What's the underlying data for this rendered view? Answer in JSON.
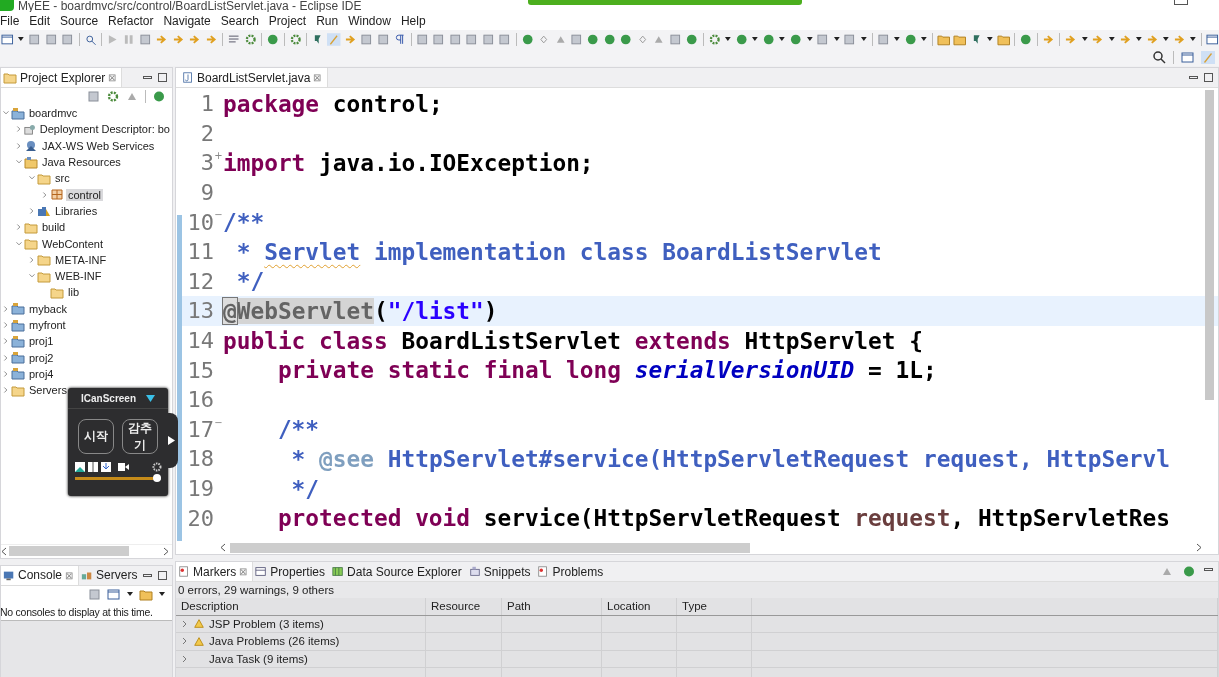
{
  "window": {
    "title": "MyEE - boardmvc/src/control/BoardListServlet.java - Eclipse IDE"
  },
  "menu": [
    "File",
    "Edit",
    "Source",
    "Refactor",
    "Navigate",
    "Search",
    "Project",
    "Run",
    "Window",
    "Help"
  ],
  "project_explorer": {
    "tab": {
      "label": "Project Explorer",
      "close": "⊠"
    },
    "tree": [
      {
        "label": "boardmvc",
        "kind": "project",
        "expanded": true,
        "selected": false,
        "children": [
          {
            "label": "Deployment Descriptor: bo",
            "kind": "descriptor",
            "expanded": false,
            "selected": false
          },
          {
            "label": "JAX-WS Web Services",
            "kind": "service",
            "expanded": false,
            "selected": false
          },
          {
            "label": "Java Resources",
            "kind": "resources",
            "expanded": true,
            "selected": false,
            "children": [
              {
                "label": "src",
                "kind": "folder",
                "expanded": true,
                "selected": false,
                "children": [
                  {
                    "label": "control",
                    "kind": "package",
                    "expanded": false,
                    "selected": true
                  }
                ]
              },
              {
                "label": "Libraries",
                "kind": "library",
                "expanded": false,
                "selected": false
              }
            ]
          },
          {
            "label": "build",
            "kind": "folder",
            "expanded": false,
            "selected": false
          },
          {
            "label": "WebContent",
            "kind": "folder",
            "expanded": true,
            "selected": false,
            "children": [
              {
                "label": "META-INF",
                "kind": "folder",
                "expanded": false,
                "selected": false
              },
              {
                "label": "WEB-INF",
                "kind": "folder",
                "expanded": true,
                "selected": false,
                "children": [
                  {
                    "label": "lib",
                    "kind": "folder",
                    "selected": false
                  }
                ]
              }
            ]
          }
        ]
      },
      {
        "label": "myback",
        "kind": "project",
        "expanded": false,
        "selected": false
      },
      {
        "label": "myfront",
        "kind": "project",
        "expanded": false,
        "selected": false
      },
      {
        "label": "proj1",
        "kind": "project",
        "expanded": false,
        "selected": false
      },
      {
        "label": "proj2",
        "kind": "project",
        "expanded": false,
        "selected": false
      },
      {
        "label": "proj4",
        "kind": "project",
        "expanded": false,
        "selected": false
      },
      {
        "label": "Servers",
        "kind": "folder",
        "expanded": false,
        "selected": false
      }
    ]
  },
  "console": {
    "tabs": [
      {
        "label": "Console",
        "close": "⊠",
        "selected": true
      },
      {
        "label": "Servers",
        "selected": false
      }
    ],
    "message": "No consoles to display at this time."
  },
  "editor": {
    "tab": {
      "label": "BoardListServlet.java",
      "close": "⊠"
    },
    "lines": [
      {
        "number": "1",
        "current": false,
        "tokens": [
          {
            "text": "package",
            "kind": "keyword"
          },
          {
            "text": " control;",
            "kind": "plain"
          }
        ]
      },
      {
        "number": "2",
        "current": false
      },
      {
        "number": "3",
        "fold": "+",
        "current": false,
        "tokens": [
          {
            "text": "import",
            "kind": "keyword"
          },
          {
            "text": " java.io.IOException;",
            "kind": "plain"
          }
        ]
      },
      {
        "number": "9",
        "current": false
      },
      {
        "number": "10",
        "fold": "−",
        "current": false,
        "tokens": [
          {
            "text": "/**",
            "kind": "javadoc"
          }
        ]
      },
      {
        "number": "11",
        "current": false,
        "tokens": [
          {
            "text": " * ",
            "kind": "javadoc"
          },
          {
            "text": "Servlet",
            "kind": "misspelled"
          },
          {
            "text": " implementation class BoardListServlet",
            "kind": "javadoc"
          }
        ]
      },
      {
        "number": "12",
        "current": false,
        "tokens": [
          {
            "text": " */",
            "kind": "javadoc"
          }
        ]
      },
      {
        "number": "13",
        "current": true,
        "tokens": [
          {
            "text": "@",
            "kind": "caret-mark"
          },
          {
            "text": "WebServlet",
            "kind": "occurrence"
          },
          {
            "text": "(",
            "kind": "plain"
          },
          {
            "text": "\"/list\"",
            "kind": "string"
          },
          {
            "text": ")",
            "kind": "plain"
          }
        ]
      },
      {
        "number": "14",
        "current": false,
        "tokens": [
          {
            "text": "public class",
            "kind": "keyword"
          },
          {
            "text": " BoardListServlet ",
            "kind": "plain"
          },
          {
            "text": "extends",
            "kind": "keyword"
          },
          {
            "text": " HttpServlet {",
            "kind": "plain"
          }
        ]
      },
      {
        "number": "15",
        "current": false,
        "tokens": [
          {
            "text": "    private static final long ",
            "kind": "keyword"
          },
          {
            "text": "serialVersionUID",
            "kind": "field"
          },
          {
            "text": " = 1L;",
            "kind": "plain"
          }
        ]
      },
      {
        "number": "16",
        "current": false
      },
      {
        "number": "17",
        "fold": "−",
        "current": false,
        "tokens": [
          {
            "text": "    /**",
            "kind": "javadoc"
          }
        ]
      },
      {
        "number": "18",
        "current": false,
        "tokens": [
          {
            "text": "     * ",
            "kind": "javadoc"
          },
          {
            "text": "@see",
            "kind": "tag"
          },
          {
            "text": " HttpServlet#service(HttpServletRequest request, HttpServl",
            "kind": "javadoc"
          }
        ]
      },
      {
        "number": "19",
        "current": false,
        "tokens": [
          {
            "text": "     */",
            "kind": "javadoc"
          }
        ]
      },
      {
        "number": "20",
        "current": false,
        "tokens": [
          {
            "text": "    protected void",
            "kind": "keyword"
          },
          {
            "text": " service(HttpServletRequest ",
            "kind": "plain"
          },
          {
            "text": "request",
            "kind": "variable"
          },
          {
            "text": ", HttpServletRes",
            "kind": "plain"
          }
        ]
      }
    ]
  },
  "markers": {
    "tabs": [
      {
        "label": "Markers",
        "close": "⊠",
        "kind": "markers",
        "selected": true
      },
      {
        "label": "Properties",
        "kind": "properties",
        "selected": false
      },
      {
        "label": "Data Source Explorer",
        "kind": "datasource",
        "selected": false
      },
      {
        "label": "Snippets",
        "kind": "snippets",
        "selected": false
      },
      {
        "label": "Problems",
        "kind": "markers",
        "selected": false
      }
    ],
    "summary": "0 errors, 29 warnings, 9 others",
    "columns": [
      "Description",
      "Resource",
      "Path",
      "Location",
      "Type"
    ],
    "rows": [
      {
        "description": "JSP Problem (3 items)",
        "kind": "warning",
        "expanded": false
      },
      {
        "description": "Java Problems (26 items)",
        "kind": "warning",
        "expanded": false
      },
      {
        "description": "Java Task (9 items)",
        "kind": "task",
        "expanded": false
      }
    ]
  },
  "recorder": {
    "title": "ICanScreen",
    "buttons": [
      "시작",
      "감추기"
    ],
    "slider": {
      "level": 0.95
    }
  }
}
